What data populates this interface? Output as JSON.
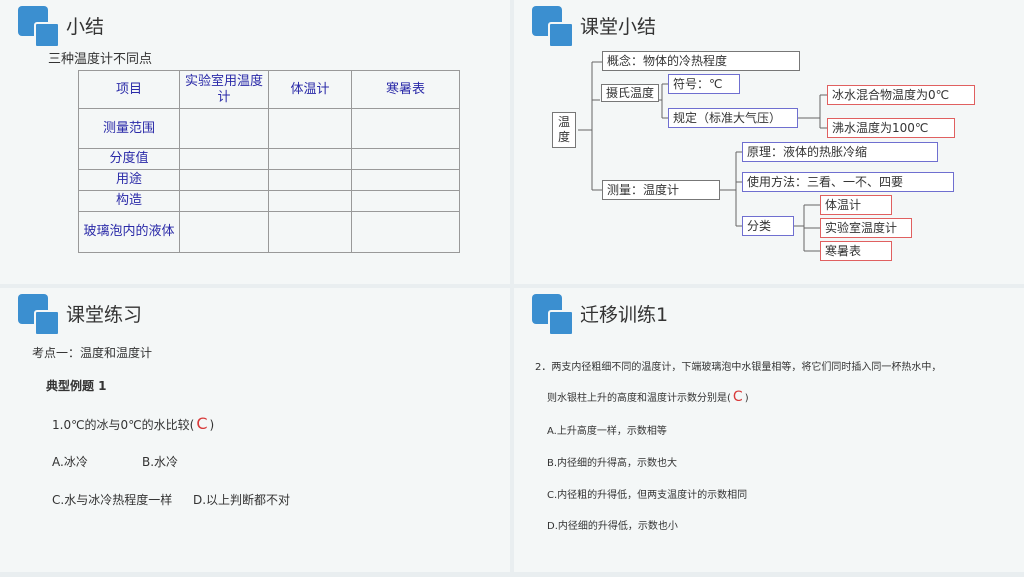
{
  "slide1": {
    "title": "小结",
    "subtitle": "三种温度计不同点",
    "headers": [
      "项目",
      "实验室用温度计",
      "体温计",
      "寒暑表"
    ],
    "rows": [
      "测量范围",
      "分度值",
      "用途",
      "构造",
      "玻璃泡内的液体"
    ]
  },
  "slide2": {
    "title": "课堂小结",
    "root": "温度",
    "concept": "概念：物体的冷热程度",
    "celsius": "摄氏温度",
    "symbol": "符号：℃",
    "rule": "规定（标准大气压）",
    "ice": "冰水混合物温度为0℃",
    "boil": "沸水温度为100℃",
    "measure": "测量：温度计",
    "principle": "原理：液体的热胀冷缩",
    "usage": "使用方法：三看、一不、四要",
    "classify": "分类",
    "types": [
      "体温计",
      "实验室温度计",
      "寒暑表"
    ]
  },
  "slide3": {
    "title": "课堂练习",
    "point": "考点一：温度和温度计",
    "example": "典型例题 1",
    "question": "1.0℃的冰与0℃的水比较(",
    "answer": "C",
    "close": ")",
    "optA": "A.冰冷",
    "optB": "B.水冷",
    "optC": "C.水与冰冷热程度一样",
    "optD": "D.以上判断都不对"
  },
  "slide4": {
    "title": "迁移训练1",
    "q1": "2．两支内径粗细不同的温度计，下端玻璃泡中水银量相等，将它们同时插入同一杯热水中，",
    "q2": "则水银柱上升的高度和温度计示数分别是(",
    "answer": "C",
    "close": ")",
    "optA": "A.上升高度一样，示数相等",
    "optB": "B.内径细的升得高，示数也大",
    "optC": "C.内径粗的升得低，但两支温度计的示数相同",
    "optD": "D.内径细的升得低，示数也小"
  }
}
